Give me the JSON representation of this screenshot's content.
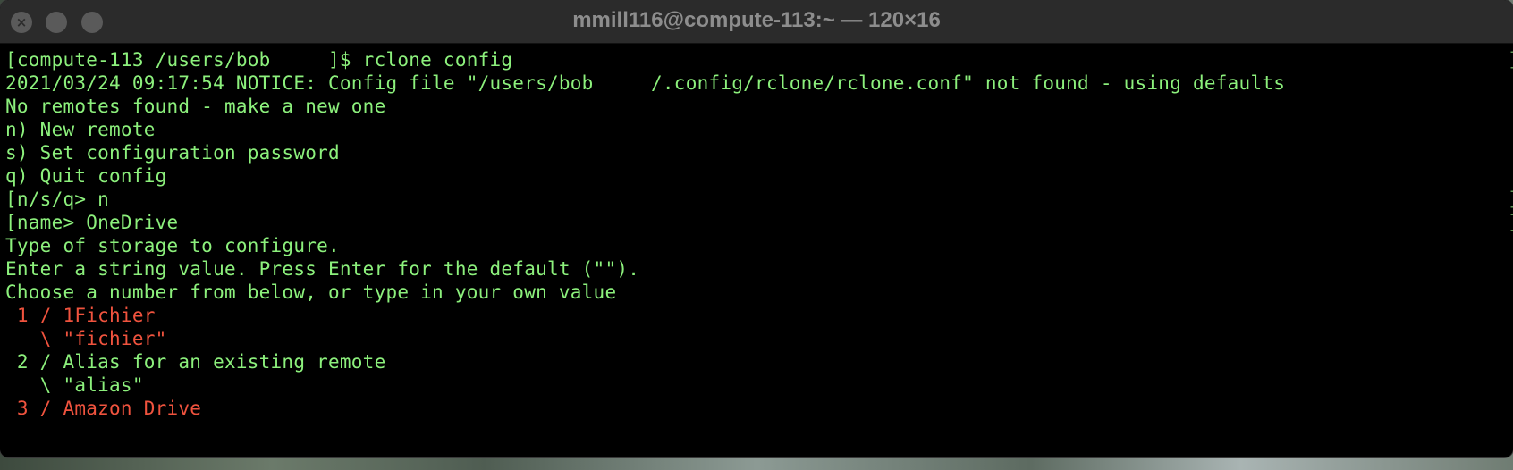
{
  "window": {
    "title": "mmill116@compute-113:~ — 120×16",
    "close_glyph": "×"
  },
  "terminal": {
    "text_color": "#8cf07c",
    "accent_color": "#f0533e",
    "lines": [
      {
        "text": "[compute-113 /users/bob     ]$ rclone config",
        "color": "green",
        "right_bracket": "]"
      },
      {
        "text": "2021/03/24 09:17:54 NOTICE: Config file \"/users/bob     /.config/rclone/rclone.conf\" not found - using defaults",
        "color": "green",
        "right_bracket": ""
      },
      {
        "text": "No remotes found - make a new one",
        "color": "green",
        "right_bracket": ""
      },
      {
        "text": "n) New remote",
        "color": "green",
        "right_bracket": ""
      },
      {
        "text": "s) Set configuration password",
        "color": "green",
        "right_bracket": ""
      },
      {
        "text": "q) Quit config",
        "color": "green",
        "right_bracket": ""
      },
      {
        "text": "[n/s/q> n",
        "color": "green",
        "right_bracket": "]"
      },
      {
        "text": "[name> OneDrive",
        "color": "green",
        "right_bracket": "]"
      },
      {
        "text": "Type of storage to configure.",
        "color": "green",
        "right_bracket": ""
      },
      {
        "text": "Enter a string value. Press Enter for the default (\"\").",
        "color": "green",
        "right_bracket": ""
      },
      {
        "text": "Choose a number from below, or type in your own value",
        "color": "green",
        "right_bracket": ""
      },
      {
        "text": " 1 / 1Fichier",
        "color": "red",
        "right_bracket": ""
      },
      {
        "text": "   \\ \"fichier\"",
        "color": "red",
        "right_bracket": ""
      },
      {
        "text": " 2 / Alias for an existing remote",
        "color": "green",
        "right_bracket": ""
      },
      {
        "text": "   \\ \"alias\"",
        "color": "green",
        "right_bracket": ""
      },
      {
        "text": " 3 / Amazon Drive",
        "color": "red",
        "right_bracket": ""
      }
    ]
  }
}
